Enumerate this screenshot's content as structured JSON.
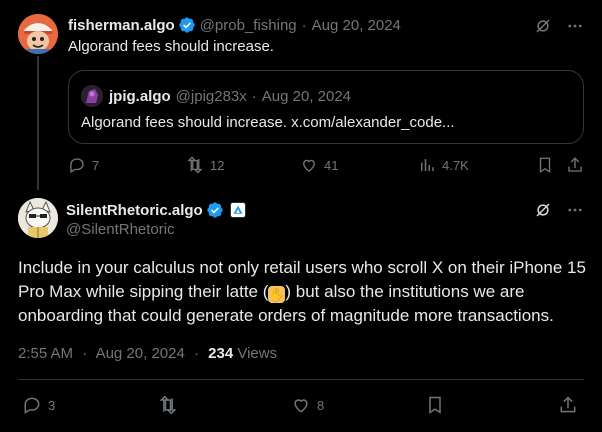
{
  "reply": {
    "name": "fisherman.algo",
    "handle": "@prob_fishing",
    "date": "Aug 20, 2024",
    "separator": "·",
    "text": "Algorand fees should increase.",
    "quote": {
      "name": "jpig.algo",
      "handle": "@jpig283x",
      "date": "Aug 20, 2024",
      "separator": "·",
      "text": "Algorand fees should increase. x.com/alexander_code..."
    },
    "actions": {
      "replies": "7",
      "reposts": "12",
      "likes": "41",
      "views": "4.7K"
    }
  },
  "main": {
    "name": "SilentRhetoric.algo",
    "handle": "@SilentRhetoric",
    "text_part1": "Include in your calculus not only retail users who scroll X on their iPhone 15 Pro Max while sipping their latte (",
    "text_part2": ") but also the institutions we are onboarding that could generate orders of magnitude more transactions.",
    "time": "2:55 AM",
    "date": "Aug 20, 2024",
    "separator": "·",
    "views_count": "234",
    "views_label": "Views",
    "actions": {
      "replies": "3",
      "likes": "8"
    }
  },
  "colors": {
    "background": "#000000",
    "text": "#e7e9ea",
    "muted": "#71767b",
    "border": "#2f3336",
    "verified": "#1d9bf0"
  },
  "icons": {
    "grok": "grok-icon",
    "more": "more-icon",
    "reply": "reply-icon",
    "repost": "repost-icon",
    "like": "like-icon",
    "views": "views-icon",
    "bookmark": "bookmark-icon",
    "share": "share-icon"
  }
}
